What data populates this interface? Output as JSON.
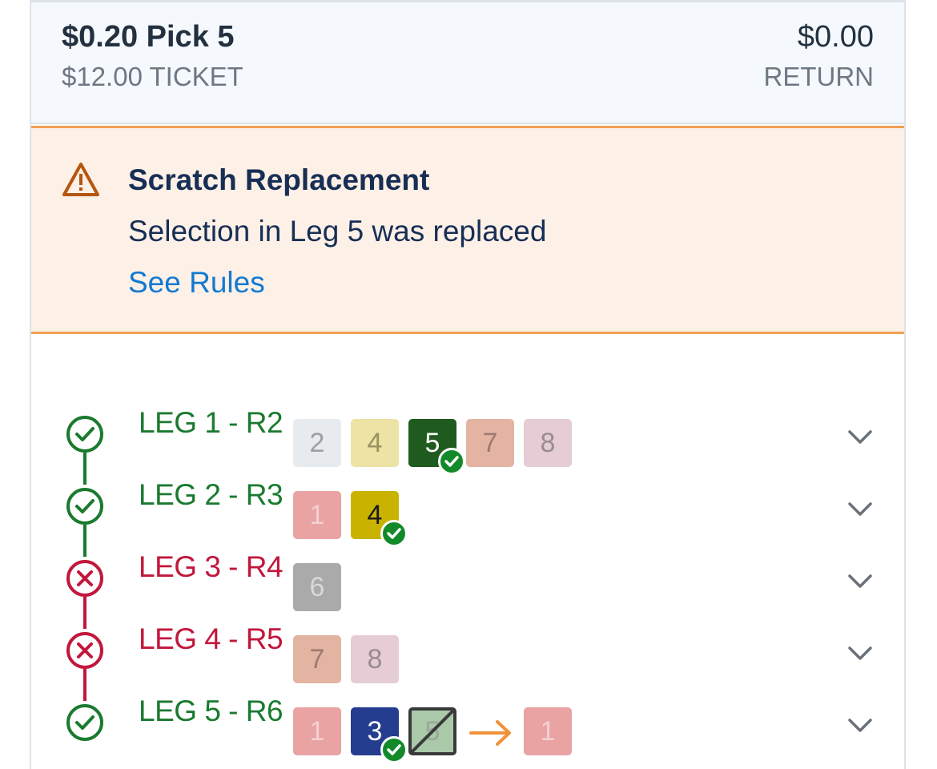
{
  "header": {
    "bet_title": "$0.20 Pick 5",
    "ticket": "$12.00 TICKET",
    "return_amount": "$0.00",
    "return_label": "RETURN"
  },
  "alert": {
    "icon": "warning-triangle-icon",
    "title": "Scratch Replacement",
    "message": "Selection in Leg 5 was replaced",
    "link": "See Rules"
  },
  "colors": {
    "win": "#1a7a2f",
    "lose": "#c2173c",
    "alert_bg": "#fdf0e6",
    "alert_border": "#f0a052",
    "link": "#1279d1"
  },
  "legs": [
    {
      "label": "LEG 1 - R2",
      "status": "win",
      "selections": [
        {
          "num": "2",
          "bg": "#e8ebee",
          "fg": "#9aa0a6"
        },
        {
          "num": "4",
          "bg": "#ece3a4",
          "fg": "#9a9262"
        },
        {
          "num": "5",
          "bg": "#1f5a1f",
          "fg": "#ffffff",
          "winner": true
        },
        {
          "num": "7",
          "bg": "#e4b4a3",
          "fg": "#9e7a6f"
        },
        {
          "num": "8",
          "bg": "#e6cdd5",
          "fg": "#9a8c90"
        }
      ]
    },
    {
      "label": "LEG 2 - R3",
      "status": "win",
      "selections": [
        {
          "num": "1",
          "bg": "#e9a3a3",
          "fg": "#f4d0d0"
        },
        {
          "num": "4",
          "bg": "#c9b300",
          "fg": "#1a1a1a",
          "winner": true
        }
      ]
    },
    {
      "label": "LEG 3 - R4",
      "status": "lose",
      "selections": [
        {
          "num": "6",
          "bg": "#aaaaaa",
          "fg": "#d8d8d8"
        }
      ]
    },
    {
      "label": "LEG 4 - R5",
      "status": "lose",
      "selections": [
        {
          "num": "7",
          "bg": "#e4b4a3",
          "fg": "#9e7a6f"
        },
        {
          "num": "8",
          "bg": "#e6cdd5",
          "fg": "#9a8c90"
        }
      ]
    },
    {
      "label": "LEG 5 - R6",
      "status": "win",
      "selections": [
        {
          "num": "1",
          "bg": "#e9a3a3",
          "fg": "#f4d0d0"
        },
        {
          "num": "3",
          "bg": "#243d8f",
          "fg": "#ffffff",
          "winner": true
        },
        {
          "num": "5",
          "bg": "#a9c9a9",
          "fg": "#9aa89a",
          "scratched": true
        }
      ],
      "replacement": {
        "num": "1",
        "bg": "#e9a3a3",
        "fg": "#f4d0d0"
      }
    }
  ]
}
